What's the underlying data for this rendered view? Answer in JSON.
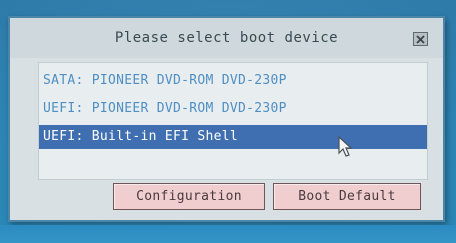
{
  "dialog": {
    "title": "Please select boot device",
    "close_icon": "close-x-icon"
  },
  "boot_devices": [
    {
      "label": "SATA: PIONEER DVD-ROM DVD-230P",
      "selected": false
    },
    {
      "label": "UEFI: PIONEER DVD-ROM DVD-230P",
      "selected": false
    },
    {
      "label": "UEFI: Built-in EFI Shell",
      "selected": true
    }
  ],
  "buttons": {
    "configuration": "Configuration",
    "boot_default": "Boot Default"
  },
  "colors": {
    "background": "#2c86b8",
    "dialog": "#d9e0e3",
    "item_text": "#4f8fc4",
    "selection": "#3f6fb0",
    "button": "#f0ced0"
  },
  "cursor_icon": "mouse-pointer-icon"
}
